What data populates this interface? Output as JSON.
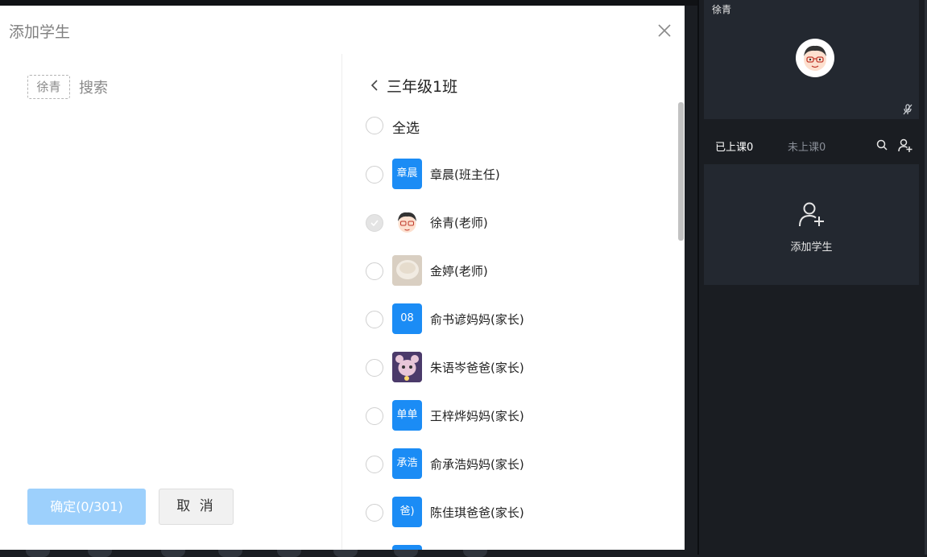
{
  "modal": {
    "title": "添加学生",
    "selected_chip": "徐青",
    "search_placeholder": "搜索",
    "confirm_label": "确定(0/301)",
    "cancel_label": "取 消",
    "class_name": "三年级1班",
    "select_all_label": "全选",
    "members": [
      {
        "name": "章晨(班主任)",
        "avatar_text": "章晨",
        "avatar_type": "text",
        "checked": false
      },
      {
        "name": "徐青(老师)",
        "avatar_text": "",
        "avatar_type": "cartoon-face",
        "checked": true
      },
      {
        "name": "金婷(老师)",
        "avatar_text": "",
        "avatar_type": "photo",
        "checked": false
      },
      {
        "name": "俞书谚妈妈(家长)",
        "avatar_text": "08",
        "avatar_type": "text",
        "checked": false
      },
      {
        "name": "朱语岑爸爸(家长)",
        "avatar_text": "",
        "avatar_type": "photo",
        "checked": false
      },
      {
        "name": "王梓烨妈妈(家长)",
        "avatar_text": "单单",
        "avatar_type": "text",
        "checked": false
      },
      {
        "name": "俞承浩妈妈(家长)",
        "avatar_text": "承浩",
        "avatar_type": "text",
        "checked": false
      },
      {
        "name": "陈佳琪爸爸(家长)",
        "avatar_text": "爸)",
        "avatar_type": "text",
        "checked": false
      }
    ]
  },
  "sidebar": {
    "video_tile_name": "徐青",
    "tab_active": "已上课0",
    "tab_inactive": "未上课0",
    "add_student_label": "添加学生"
  },
  "colors": {
    "avatar_blue": "#1b8cf5",
    "confirm_disabled": "#9dd0fc",
    "dark_bg": "#1a1d22",
    "card_bg": "#232830"
  }
}
